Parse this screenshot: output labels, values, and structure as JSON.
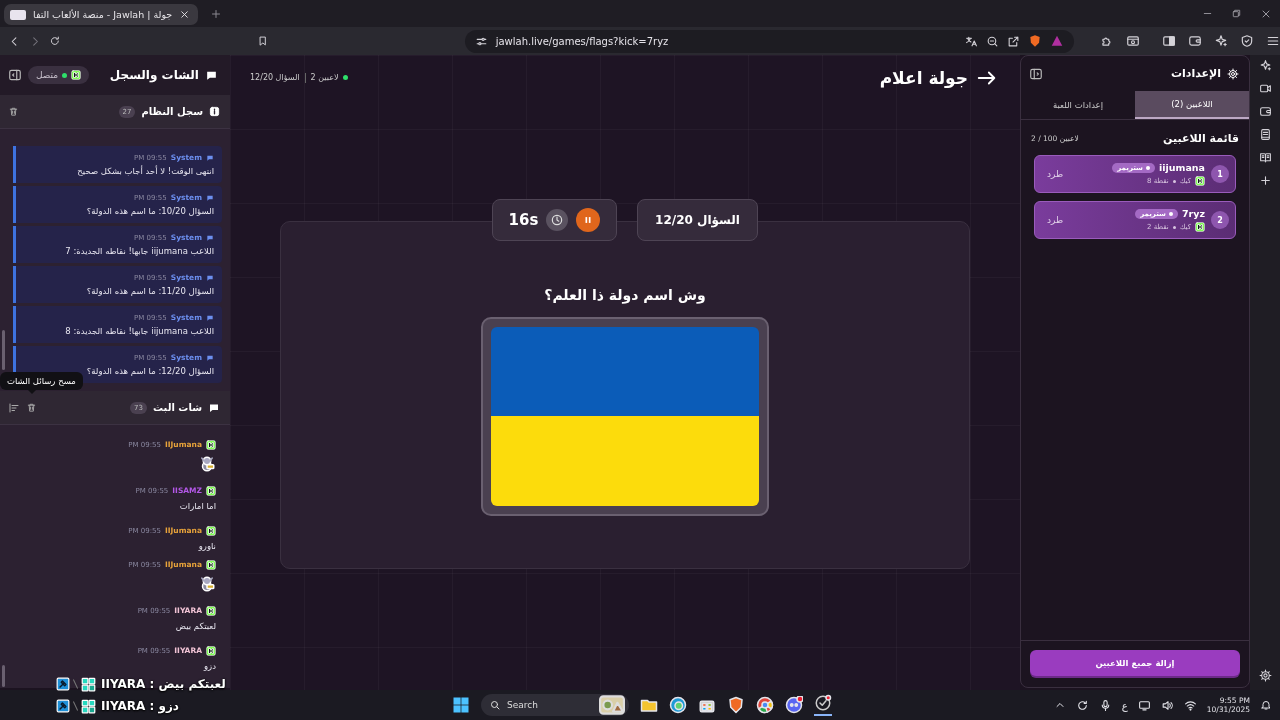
{
  "browser": {
    "tab_title": "جولة | Jawlah - منصة الألعاب التفا",
    "url": "jawlah.live/games/flags?kick=7ryz"
  },
  "chat_panel": {
    "title": "الشات والسجل",
    "status": "متصل",
    "connected": true,
    "system_log": {
      "title": "سجل النظام",
      "count": "27",
      "messages": [
        {
          "sender": "System",
          "time": "09:55 PM",
          "text": "انتهى الوقت! لا أحد أجاب بشكل صحيح"
        },
        {
          "sender": "System",
          "time": "09:55 PM",
          "text": "السؤال 10/20: ما اسم هذه الدولة؟"
        },
        {
          "sender": "System",
          "time": "09:55 PM",
          "text": "اللاعب iijumana جابها! نقاطه الجديدة: 7"
        },
        {
          "sender": "System",
          "time": "09:55 PM",
          "text": "السؤال 11/20: ما اسم هذه الدولة؟"
        },
        {
          "sender": "System",
          "time": "09:55 PM",
          "text": "اللاعب iijumana جابها! نقاطه الجديدة: 8"
        },
        {
          "sender": "System",
          "time": "09:55 PM",
          "text": "السؤال 12/20: ما اسم هذه الدولة؟"
        }
      ]
    },
    "tooltip": "مسح رسائل الشات",
    "stream_chat": {
      "title": "شات البث",
      "count": "73",
      "messages": [
        {
          "user": "IIJumana",
          "color": "#e8a33a",
          "time": "09:55 PM",
          "kind": "sticker"
        },
        {
          "user": "IISAMZ",
          "color": "#b458e8",
          "time": "09:55 PM",
          "kind": "text",
          "text": "اما امارات"
        },
        {
          "user": "IIJumana",
          "color": "#e8a33a",
          "time": "09:55 PM",
          "kind": "text",
          "text": "ناورو"
        },
        {
          "user": "IIJumana",
          "color": "#e8a33a",
          "time": "09:55 PM",
          "kind": "sticker"
        },
        {
          "user": "IIYARA",
          "color": "#f2c4d6",
          "time": "09:55 PM",
          "kind": "text",
          "text": "لعبتكم بيض"
        },
        {
          "user": "IIYARA",
          "color": "#f2c4d6",
          "time": "09:55 PM",
          "kind": "text",
          "text": "دزو"
        }
      ]
    }
  },
  "game": {
    "title": "جولة اعلام",
    "players_online": "2 لاعبين",
    "progress": "السؤال 12/20",
    "timer": "16s",
    "question_counter": "السؤال 12/20",
    "question": "وش اسم دولة ذا العلم؟"
  },
  "settings_panel": {
    "title": "الإعدادات",
    "tabs": [
      {
        "label": "اللاعبين (2)",
        "selected": true
      },
      {
        "label": "إعدادات اللعبة",
        "selected": false
      }
    ],
    "list_title": "قائمة اللاعبين",
    "capacity": "2 / 100 لاعبين",
    "players": [
      {
        "rank": "1",
        "name": "iijumana",
        "role": "ستريمر",
        "platform": "كيك",
        "points": "8 نقطة",
        "action": "طرد"
      },
      {
        "rank": "2",
        "name": "7ryz",
        "role": "ستريمر",
        "platform": "كيك",
        "points": "2 نقطة",
        "action": "طرد"
      }
    ],
    "remove_all": "إزالة جميع اللاعبين"
  },
  "overlay": {
    "lines": [
      "IIYARA : لعبتكم بيض",
      "IIYARA : دزو"
    ]
  },
  "taskbar": {
    "search": "Search",
    "language": "ع",
    "time": "9:55 PM",
    "date": "10/31/2025"
  }
}
